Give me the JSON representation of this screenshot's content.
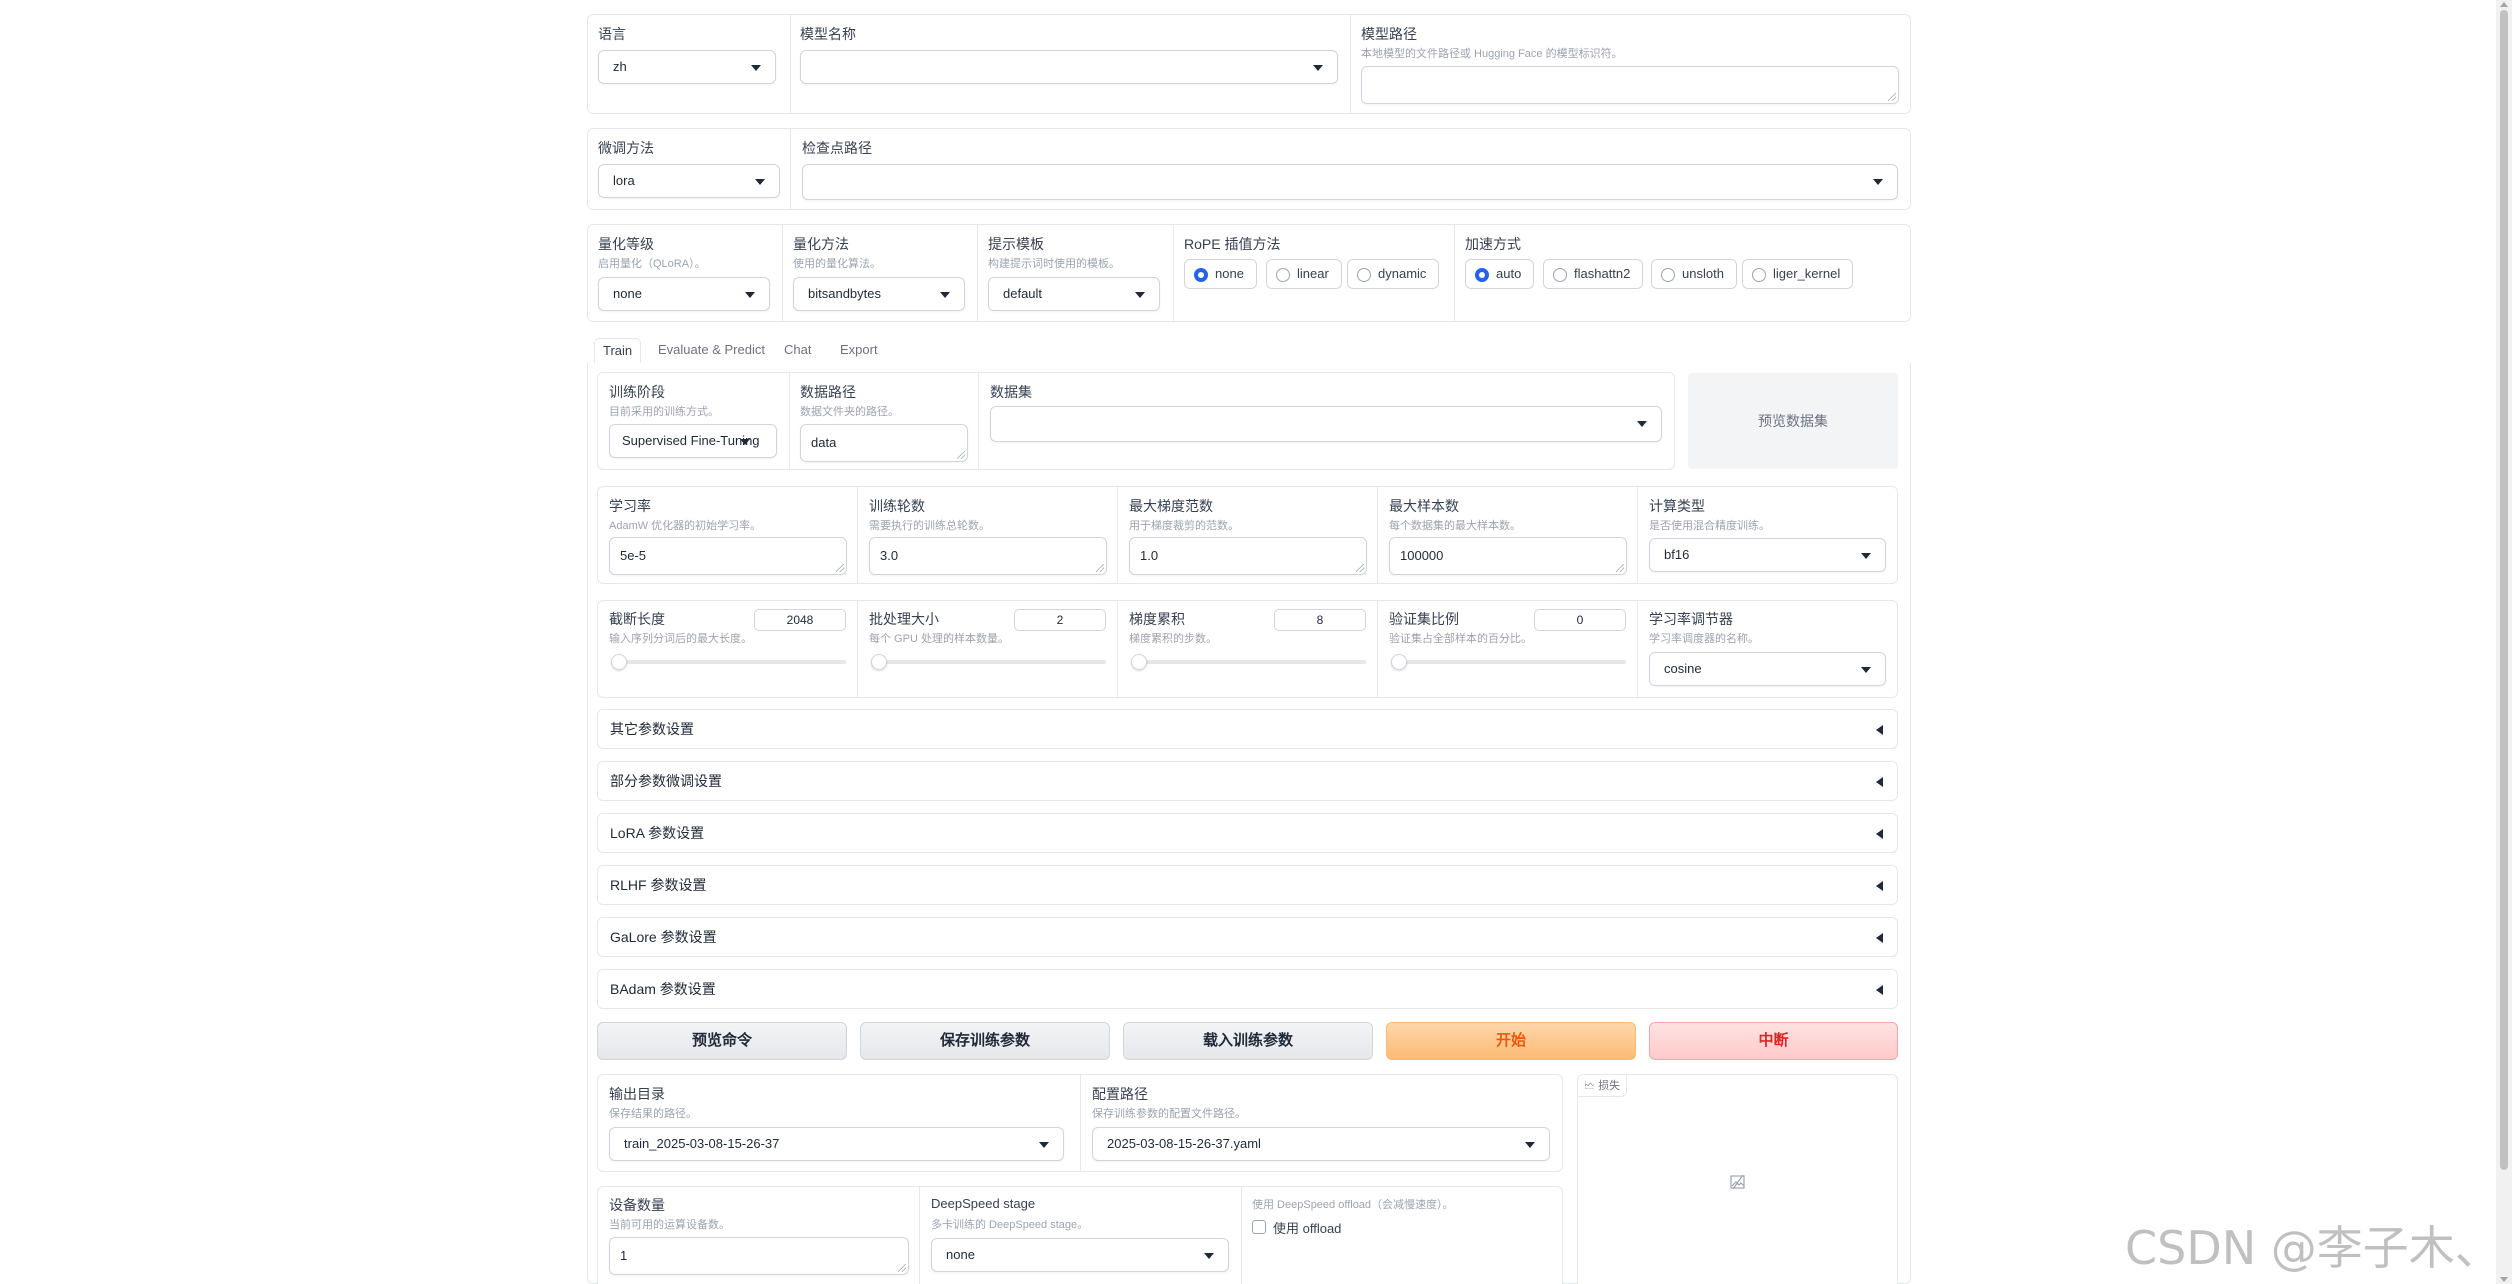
{
  "top": {
    "language": {
      "label": "语言",
      "value": "zh"
    },
    "model_name": {
      "label": "模型名称",
      "value": ""
    },
    "model_path": {
      "label": "模型路径",
      "info": "本地模型的文件路径或 Hugging Face 的模型标识符。",
      "value": ""
    },
    "finetune_method": {
      "label": "微调方法",
      "value": "lora"
    },
    "checkpoint_path": {
      "label": "检查点路径",
      "value": ""
    },
    "quant_bit": {
      "label": "量化等级",
      "info": "启用量化（QLoRA）。",
      "value": "none"
    },
    "quant_method": {
      "label": "量化方法",
      "info": "使用的量化算法。",
      "value": "bitsandbytes"
    },
    "template": {
      "label": "提示模板",
      "info": "构建提示词时使用的模板。",
      "value": "default"
    },
    "rope": {
      "label": "RoPE 插值方法",
      "options": [
        "none",
        "linear",
        "dynamic"
      ],
      "selected": "none"
    },
    "booster": {
      "label": "加速方式",
      "options": [
        "auto",
        "flashattn2",
        "unsloth",
        "liger_kernel"
      ],
      "selected": "auto"
    }
  },
  "tabs": [
    "Train",
    "Evaluate & Predict",
    "Chat",
    "Export"
  ],
  "active_tab": "Train",
  "train": {
    "stage": {
      "label": "训练阶段",
      "info": "目前采用的训练方式。",
      "value": "Supervised Fine-Tuning"
    },
    "dataset_dir": {
      "label": "数据路径",
      "info": "数据文件夹的路径。",
      "value": "data"
    },
    "dataset": {
      "label": "数据集",
      "value": ""
    },
    "preview_dataset": "预览数据集",
    "learning_rate": {
      "label": "学习率",
      "info": "AdamW 优化器的初始学习率。",
      "value": "5e-5"
    },
    "epochs": {
      "label": "训练轮数",
      "info": "需要执行的训练总轮数。",
      "value": "3.0"
    },
    "max_grad_norm": {
      "label": "最大梯度范数",
      "info": "用于梯度裁剪的范数。",
      "value": "1.0"
    },
    "max_samples": {
      "label": "最大样本数",
      "info": "每个数据集的最大样本数。",
      "value": "100000"
    },
    "compute_type": {
      "label": "计算类型",
      "info": "是否使用混合精度训练。",
      "value": "bf16"
    },
    "cutoff_len": {
      "label": "截断长度",
      "info": "输入序列分词后的最大长度。",
      "value": "2048",
      "fraction": 0.0
    },
    "batch_size": {
      "label": "批处理大小",
      "info": "每个 GPU 处理的样本数量。",
      "value": "2",
      "fraction": 0.0
    },
    "grad_accum": {
      "label": "梯度累积",
      "info": "梯度累积的步数。",
      "value": "8",
      "fraction": 0.0
    },
    "val_size": {
      "label": "验证集比例",
      "info": "验证集占全部样本的百分比。",
      "value": "0",
      "fraction": 0.0
    },
    "lr_scheduler": {
      "label": "学习率调节器",
      "info": "学习率调度器的名称。",
      "value": "cosine"
    },
    "accordions": [
      "其它参数设置",
      "部分参数微调设置",
      "LoRA 参数设置",
      "RLHF 参数设置",
      "GaLore 参数设置",
      "BAdam 参数设置"
    ],
    "buttons": {
      "preview_cmd": "预览命令",
      "save_args": "保存训练参数",
      "load_args": "载入训练参数",
      "start": "开始",
      "stop": "中断"
    },
    "output_dir": {
      "label": "输出目录",
      "info": "保存结果的路径。",
      "value": "train_2025-03-08-15-26-37"
    },
    "config_path": {
      "label": "配置路径",
      "info": "保存训练参数的配置文件路径。",
      "value": "2025-03-08-15-26-37.yaml"
    },
    "device_count": {
      "label": "设备数量",
      "info": "当前可用的运算设备数。",
      "value": "1"
    },
    "ds_stage": {
      "label": "DeepSpeed stage",
      "info": "多卡训练的 DeepSpeed stage。",
      "value": "none"
    },
    "ds_offload": {
      "info": "使用 DeepSpeed offload（会减慢速度）。",
      "label": "使用 offload"
    },
    "loss_plot": {
      "label": "损失"
    }
  },
  "watermark": "CSDN @李子木、",
  "colors": {
    "accent": "#2563eb",
    "start": "#ea580c",
    "stop": "#dc2626"
  }
}
